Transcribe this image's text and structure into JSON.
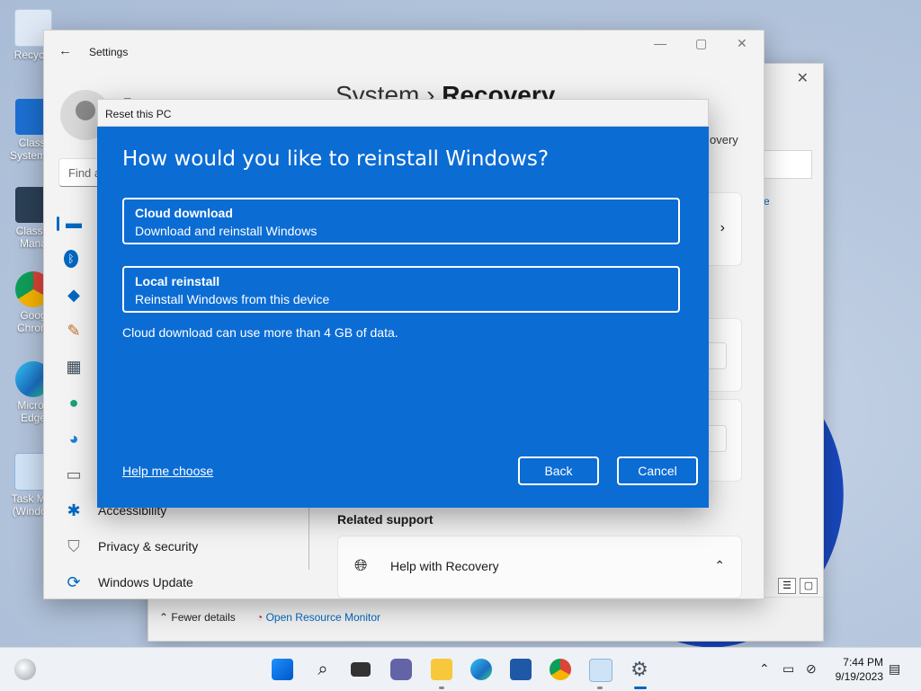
{
  "desktop": {
    "icons": [
      {
        "label": "Recycle",
        "name": "recycle-bin-icon"
      },
      {
        "label": "Classi System C",
        "name": "classic-system-config-icon"
      },
      {
        "label": "Classic Mana",
        "name": "classic-manager-icon"
      },
      {
        "label": "Goog Chrom",
        "name": "chrome-desktop-icon"
      },
      {
        "label": "Micros Edge",
        "name": "edge-desktop-icon"
      },
      {
        "label": "Task Mar (Window",
        "name": "task-manager-desktop-icon"
      }
    ]
  },
  "task_manager": {
    "fewer_details": "Fewer details",
    "open_resource_monitor": "Open Resource Monitor",
    "link_peek": "e"
  },
  "settings": {
    "title": "Settings",
    "user_name": "E",
    "find_placeholder": "Find a",
    "header_parent": "System",
    "header_sep": "›",
    "header_current": "Recovery",
    "recovery_peek": "overy",
    "nav": [
      {
        "label": "",
        "name": "nav-system"
      },
      {
        "label": "",
        "name": "nav-bluetooth"
      },
      {
        "label": "",
        "name": "nav-network"
      },
      {
        "label": "",
        "name": "nav-personalization"
      },
      {
        "label": "",
        "name": "nav-apps"
      },
      {
        "label": "",
        "name": "nav-accounts"
      },
      {
        "label": "",
        "name": "nav-time-language"
      },
      {
        "label": "",
        "name": "nav-gaming"
      },
      {
        "label": "Accessibility",
        "name": "nav-accessibility"
      },
      {
        "label": "Privacy & security",
        "name": "nav-privacy-security"
      },
      {
        "label": "Windows Update",
        "name": "nav-windows-update"
      }
    ],
    "related_support": "Related support",
    "help_with_recovery": "Help with Recovery"
  },
  "dialog": {
    "title": "Reset this PC",
    "question": "How would you like to reinstall Windows?",
    "options": [
      {
        "title": "Cloud download",
        "subtitle": "Download and reinstall Windows"
      },
      {
        "title": "Local reinstall",
        "subtitle": "Reinstall Windows from this device"
      }
    ],
    "note": "Cloud download can use more than 4 GB of data.",
    "help_link": "Help me choose",
    "back": "Back",
    "cancel": "Cancel"
  },
  "taskbar": {
    "time": "7:44 PM",
    "date": "9/19/2023"
  },
  "colors": {
    "dialog_bg": "#0b6cd4",
    "accent": "#0067c0"
  }
}
